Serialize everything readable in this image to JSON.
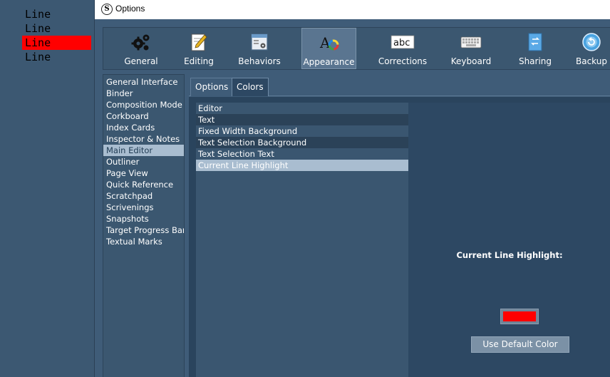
{
  "editor": {
    "lines": [
      "Line",
      "Line",
      "Line",
      "Line"
    ],
    "highlight_color": "#ff0000"
  },
  "window": {
    "title": "Options",
    "app_icon_glyph": "S"
  },
  "toolbar": {
    "items": [
      {
        "label": "General",
        "icon": "gears-icon"
      },
      {
        "label": "Editing",
        "icon": "pencil-document-icon"
      },
      {
        "label": "Behaviors",
        "icon": "window-gear-icon"
      },
      {
        "label": "Appearance",
        "icon": "font-color-wheel-icon"
      },
      {
        "label": "Corrections",
        "icon": "abc-spellcheck-icon"
      },
      {
        "label": "Keyboard",
        "icon": "keyboard-icon"
      },
      {
        "label": "Sharing",
        "icon": "sync-document-icon"
      },
      {
        "label": "Backup",
        "icon": "backup-circle-icon"
      }
    ],
    "active": "Appearance"
  },
  "categories": {
    "items": [
      "General Interface",
      "Binder",
      "Composition Mode",
      "Corkboard",
      "Index Cards",
      "Inspector & Notes",
      "Main Editor",
      "Outliner",
      "Page View",
      "Quick Reference",
      "Scratchpad",
      "Scrivenings",
      "Snapshots",
      "Target Progress Bars",
      "Textual Marks"
    ],
    "selected": "Main Editor"
  },
  "tabs": {
    "items": [
      "Options",
      "Colors"
    ],
    "active": "Colors"
  },
  "colors": {
    "items": [
      "Editor",
      "Text",
      "Fixed Width Background",
      "Text Selection Background",
      "Text Selection Text",
      "Current Line Highlight"
    ],
    "selected": "Current Line Highlight",
    "detail_title": "Current Line Highlight:",
    "swatch_color": "#ff0000",
    "default_button_label": "Use Default Color"
  }
}
